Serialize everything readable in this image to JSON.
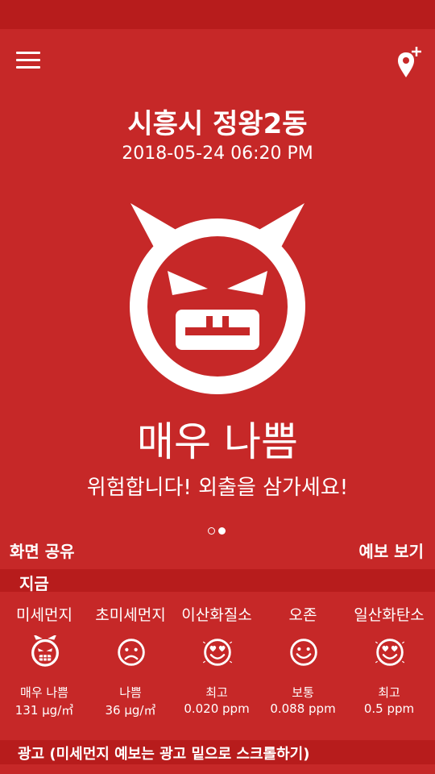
{
  "header": {
    "location": "시흥시 정왕2동",
    "datetime": "2018-05-24 06:20 PM",
    "menu_icon": "hamburger-menu-icon",
    "add_location_icon": "add-location-pin-icon"
  },
  "status": {
    "face_icon": "devil-face-icon",
    "grade": "매우 나쁨",
    "message": "위험합니다! 외출을 삼가세요!",
    "page_indicator": {
      "pages": 2,
      "current": 2
    }
  },
  "actions": {
    "share": "화면 공유",
    "forecast": "예보 보기"
  },
  "now_section": {
    "title": "지금",
    "items": [
      {
        "name": "미세먼지",
        "icon": "devil-face-icon",
        "grade": "매우 나쁨",
        "value": "131 μg/㎥"
      },
      {
        "name": "초미세먼지",
        "icon": "sad-face-icon",
        "grade": "나쁨",
        "value": "36 μg/㎥"
      },
      {
        "name": "이산화질소",
        "icon": "heart-eyes-face-icon",
        "grade": "최고",
        "value": "0.020 ppm"
      },
      {
        "name": "오존",
        "icon": "smile-face-icon",
        "grade": "보통",
        "value": "0.088 ppm"
      },
      {
        "name": "일산화탄소",
        "icon": "heart-eyes-face-icon",
        "grade": "최고",
        "value": "0.5 ppm"
      }
    ]
  },
  "ad_bar": {
    "text": "광고 (미세먼지 예보는 광고 밑으로 스크롤하기)"
  },
  "colors": {
    "background": "#c62828",
    "section_bar": "#b71c1c",
    "foreground": "#ffffff"
  }
}
